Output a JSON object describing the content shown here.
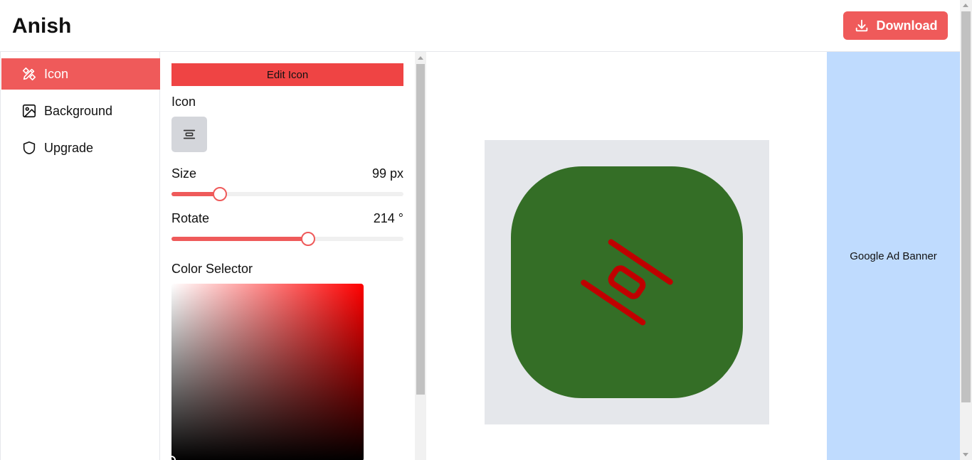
{
  "app": {
    "brand": "Anish",
    "download_label": "Download"
  },
  "sidebar": {
    "items": [
      {
        "label": "Icon",
        "icon": "pen-ruler-icon",
        "active": true
      },
      {
        "label": "Background",
        "icon": "image-icon",
        "active": false
      },
      {
        "label": "Upgrade",
        "icon": "shield-icon",
        "active": false
      }
    ]
  },
  "panel": {
    "edit_button": "Edit Icon",
    "icon_label": "Icon",
    "size_label": "Size",
    "size_value": "99 px",
    "size_fraction": 0.21,
    "rotate_label": "Rotate",
    "rotate_value": "214 °",
    "rotate_fraction": 0.59,
    "color_label": "Color Selector"
  },
  "preview": {
    "background_color": "#e5e7eb",
    "icon_bg_color": "#346e26",
    "icon_color": "#c00000",
    "rotation_deg": 214,
    "icon": "align-center-icon"
  },
  "ad": {
    "label": "Google Ad Banner"
  },
  "colors": {
    "accent": "#ef5a5a",
    "ad_bg": "#bfdbfe"
  }
}
